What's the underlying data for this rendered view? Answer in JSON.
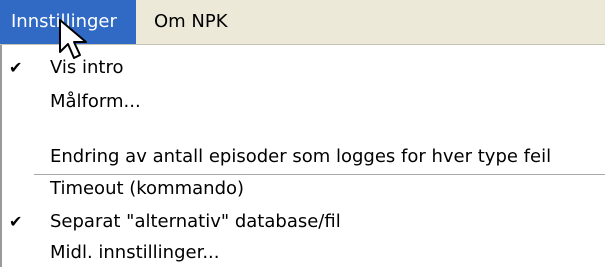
{
  "menubar": {
    "items": [
      {
        "label": "Innstillinger"
      },
      {
        "label": "Om NPK"
      }
    ]
  },
  "menu": {
    "items": [
      {
        "label": "Vis intro",
        "checked": true
      },
      {
        "label": "Målform..."
      },
      {
        "label": "Endring av antall episoder som logges for hver type feil"
      },
      {
        "label": "Timeout (kommando)"
      },
      {
        "label": "Separat \"alternativ\" database/fil",
        "checked": true
      },
      {
        "label": "Midl. innstillinger..."
      }
    ]
  },
  "icons": {
    "check": "check-icon",
    "cursor": "mouse-pointer-icon"
  },
  "colors": {
    "menubar_bg": "#ece9d8",
    "highlight": "#316ac5",
    "menu_bg": "#ffffff"
  }
}
